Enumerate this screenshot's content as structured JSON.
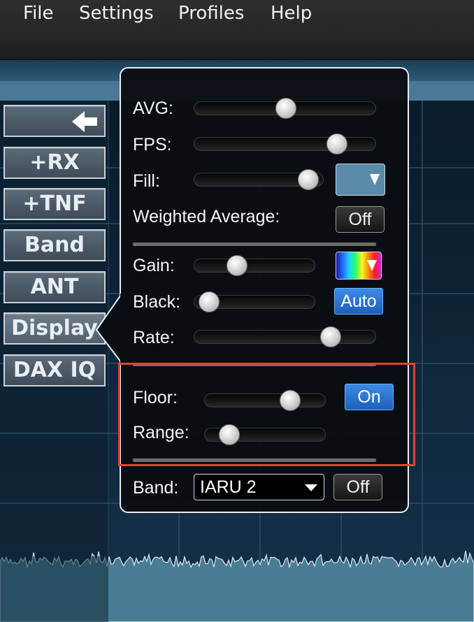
{
  "menu": {
    "items": [
      "File",
      "Settings",
      "Profiles",
      "Help"
    ]
  },
  "side_buttons": [
    "+RX",
    "+TNF",
    "Band",
    "ANT",
    "Display",
    "DAX IQ"
  ],
  "panel": {
    "avg_label": "AVG:",
    "avg_level": 0.5,
    "fps_label": "FPS:",
    "fps_level": 0.82,
    "fill_label": "Fill:",
    "fill_level": 0.95,
    "fill_color": "#5a8ba8",
    "weighted_label": "Weighted Average:",
    "weighted_value": "Off",
    "gain_label": "Gain:",
    "gain_level": 0.32,
    "black_label": "Black:",
    "black_level": 0.04,
    "black_auto": "Auto",
    "rate_label": "Rate:",
    "rate_level": 0.78,
    "floor_label": "Floor:",
    "floor_level": 0.74,
    "floor_toggle": "On",
    "range_label": "Range:",
    "range_level": 0.14,
    "band_label": "Band:",
    "band_value": "IARU 2",
    "band_toggle": "Off"
  },
  "colors": {
    "accent_on": "#2a72d4",
    "highlight": "#e0432d",
    "pan_bg": "#0c1a26",
    "spectrum_fill": "#4a7c94"
  }
}
